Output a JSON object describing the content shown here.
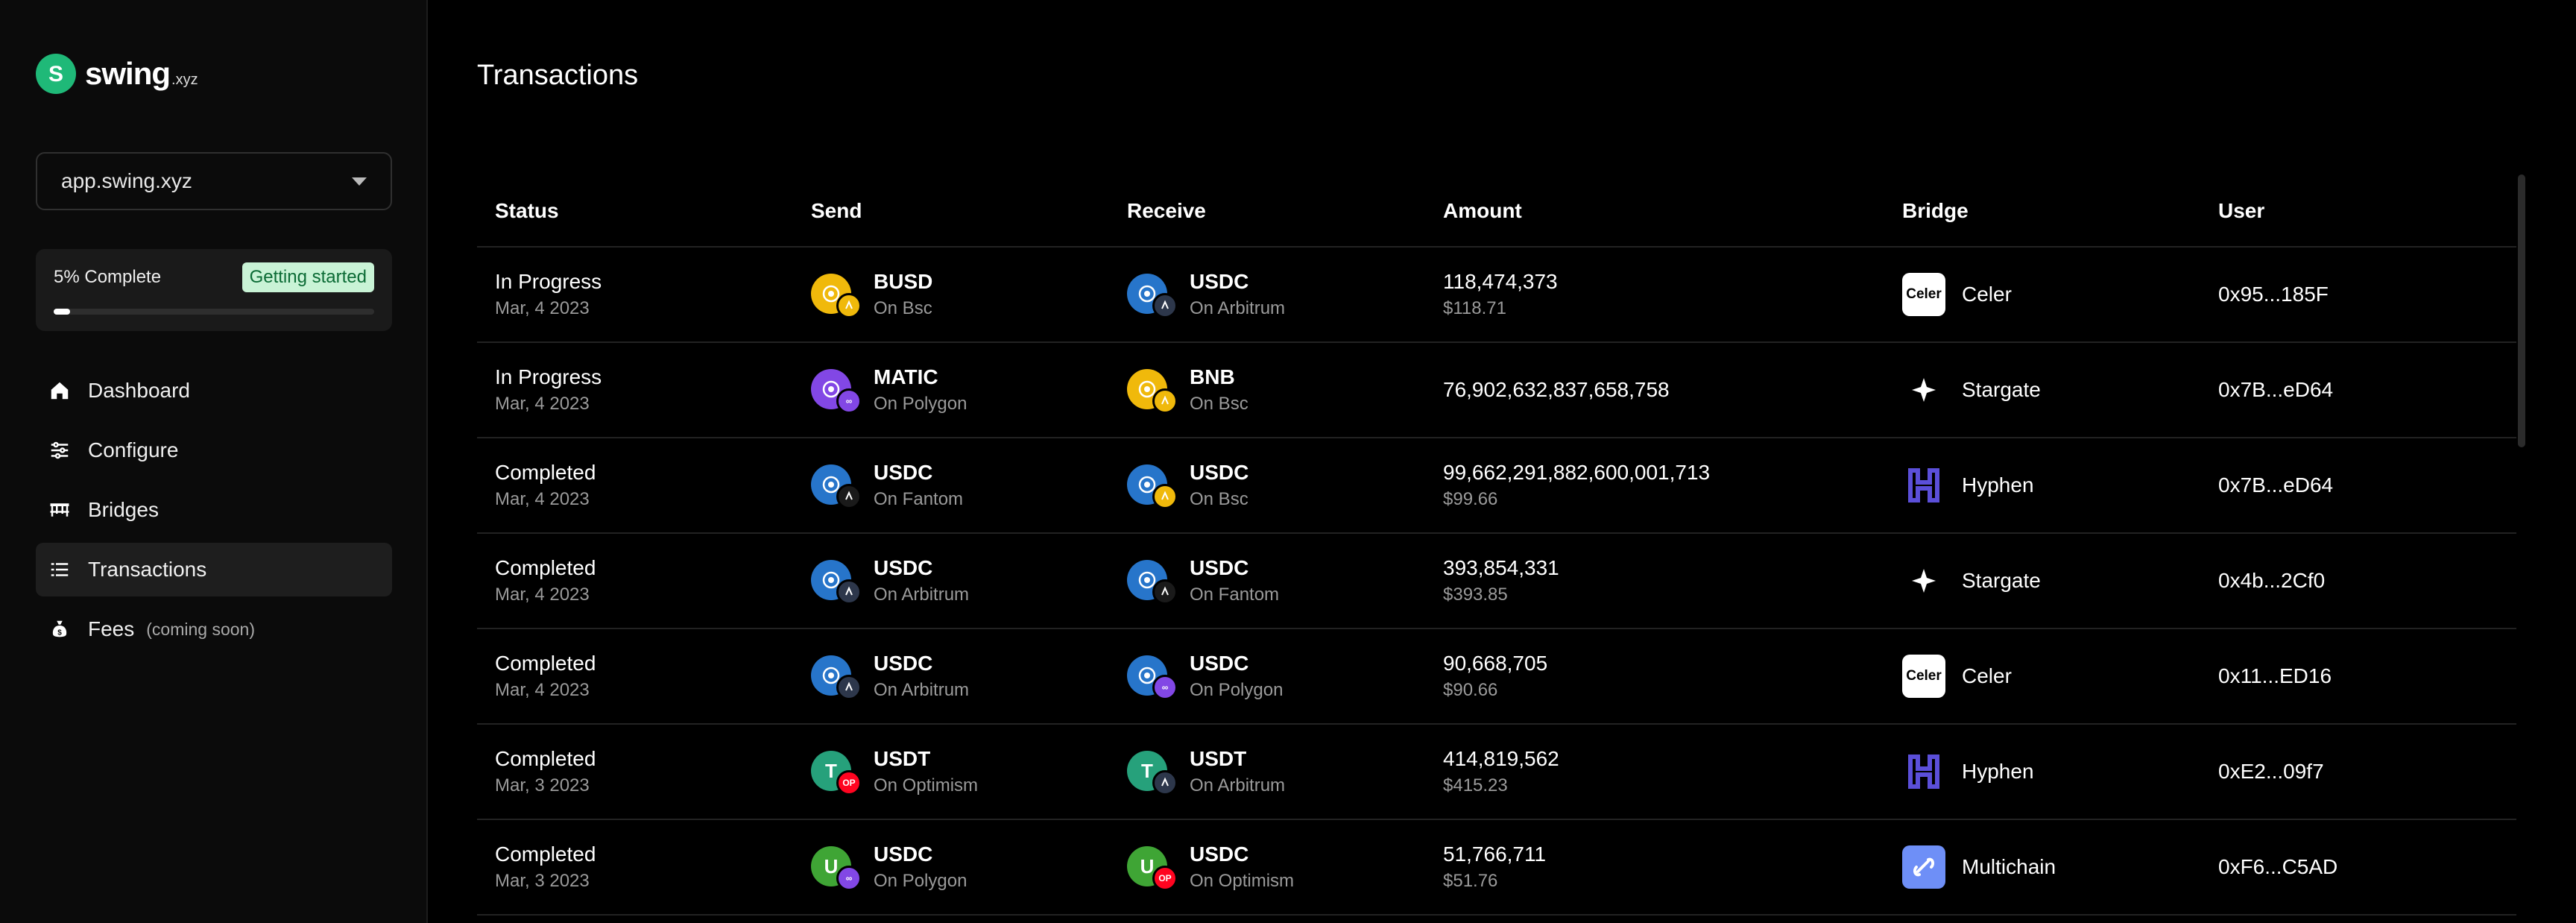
{
  "brand": {
    "name": "swing",
    "tld": ".xyz"
  },
  "env_select": {
    "value": "app.swing.xyz"
  },
  "progress": {
    "label": "5% Complete",
    "badge": "Getting started",
    "fraction": 0.05
  },
  "nav": [
    {
      "label": "Dashboard",
      "icon": "home-icon",
      "note": ""
    },
    {
      "label": "Configure",
      "icon": "sliders-icon",
      "note": ""
    },
    {
      "label": "Bridges",
      "icon": "bridge-icon",
      "note": ""
    },
    {
      "label": "Transactions",
      "icon": "list-icon",
      "note": "",
      "active": true
    },
    {
      "label": "Fees",
      "icon": "money-bag-icon",
      "note": "(coming soon)"
    }
  ],
  "page_title": "Transactions",
  "table": {
    "headers": [
      "Status",
      "Send",
      "Receive",
      "Amount",
      "Bridge",
      "User"
    ],
    "rows": [
      {
        "status": "In Progress",
        "date": "Mar, 4 2023",
        "send": {
          "token": "BUSD",
          "chain": "On Bsc",
          "color": "#f0b90b",
          "glyph": "",
          "chain_color": "#f0b90b",
          "chain_glyph": ""
        },
        "recv": {
          "token": "USDC",
          "chain": "On Arbitrum",
          "color": "#2775ca",
          "glyph": "",
          "chain_color": "#2d374b",
          "chain_glyph": ""
        },
        "amount": "118,474,373",
        "usd": "$118.71",
        "bridge": {
          "name": "Celer",
          "logo": "Celer",
          "bg": "#ffffff",
          "fg": "#000000"
        },
        "user": "0x95...185F"
      },
      {
        "status": "In Progress",
        "date": "Mar, 4 2023",
        "send": {
          "token": "MATIC",
          "chain": "On Polygon",
          "color": "#8247e5",
          "glyph": "",
          "chain_color": "#8247e5",
          "chain_glyph": "∞"
        },
        "recv": {
          "token": "BNB",
          "chain": "On Bsc",
          "color": "#f0b90b",
          "glyph": "",
          "chain_color": "#f0b90b",
          "chain_glyph": ""
        },
        "amount": "76,902,632,837,658,758",
        "usd": "",
        "bridge": {
          "name": "Stargate",
          "logo": "",
          "bg": "#000000",
          "fg": "#ffffff"
        },
        "user": "0x7B...eD64"
      },
      {
        "status": "Completed",
        "date": "Mar, 4 2023",
        "send": {
          "token": "USDC",
          "chain": "On Fantom",
          "color": "#2775ca",
          "glyph": "",
          "chain_color": "#1a1a1a",
          "chain_glyph": ""
        },
        "recv": {
          "token": "USDC",
          "chain": "On Bsc",
          "color": "#2775ca",
          "glyph": "",
          "chain_color": "#f0b90b",
          "chain_glyph": ""
        },
        "amount": "99,662,291,882,600,001,713",
        "usd": "$99.66",
        "bridge": {
          "name": "Hyphen",
          "logo": "",
          "bg": "#000000",
          "fg": "#5b4fd9"
        },
        "user": "0x7B...eD64"
      },
      {
        "status": "Completed",
        "date": "Mar, 4 2023",
        "send": {
          "token": "USDC",
          "chain": "On Arbitrum",
          "color": "#2775ca",
          "glyph": "",
          "chain_color": "#2d374b",
          "chain_glyph": ""
        },
        "recv": {
          "token": "USDC",
          "chain": "On Fantom",
          "color": "#2775ca",
          "glyph": "",
          "chain_color": "#1a1a1a",
          "chain_glyph": ""
        },
        "amount": "393,854,331",
        "usd": "$393.85",
        "bridge": {
          "name": "Stargate",
          "logo": "",
          "bg": "#000000",
          "fg": "#ffffff"
        },
        "user": "0x4b...2Cf0"
      },
      {
        "status": "Completed",
        "date": "Mar, 4 2023",
        "send": {
          "token": "USDC",
          "chain": "On Arbitrum",
          "color": "#2775ca",
          "glyph": "",
          "chain_color": "#2d374b",
          "chain_glyph": ""
        },
        "recv": {
          "token": "USDC",
          "chain": "On Polygon",
          "color": "#2775ca",
          "glyph": "",
          "chain_color": "#8247e5",
          "chain_glyph": "∞"
        },
        "amount": "90,668,705",
        "usd": "$90.66",
        "bridge": {
          "name": "Celer",
          "logo": "Celer",
          "bg": "#ffffff",
          "fg": "#000000"
        },
        "user": "0x11...ED16"
      },
      {
        "status": "Completed",
        "date": "Mar, 3 2023",
        "send": {
          "token": "USDT",
          "chain": "On Optimism",
          "color": "#26a17b",
          "glyph": "T",
          "chain_color": "#ff0420",
          "chain_glyph": "OP"
        },
        "recv": {
          "token": "USDT",
          "chain": "On Arbitrum",
          "color": "#26a17b",
          "glyph": "T",
          "chain_color": "#2d374b",
          "chain_glyph": ""
        },
        "amount": "414,819,562",
        "usd": "$415.23",
        "bridge": {
          "name": "Hyphen",
          "logo": "",
          "bg": "#000000",
          "fg": "#5b4fd9"
        },
        "user": "0xE2...09f7"
      },
      {
        "status": "Completed",
        "date": "Mar, 3 2023",
        "send": {
          "token": "USDC",
          "chain": "On Polygon",
          "color": "#3fa535",
          "glyph": "U",
          "chain_color": "#8247e5",
          "chain_glyph": "∞"
        },
        "recv": {
          "token": "USDC",
          "chain": "On Optimism",
          "color": "#3fa535",
          "glyph": "U",
          "chain_color": "#ff0420",
          "chain_glyph": "OP"
        },
        "amount": "51,766,711",
        "usd": "$51.76",
        "bridge": {
          "name": "Multichain",
          "logo": "",
          "bg": "#6e8ff7",
          "fg": "#ffffff"
        },
        "user": "0xF6...C5AD"
      }
    ]
  }
}
